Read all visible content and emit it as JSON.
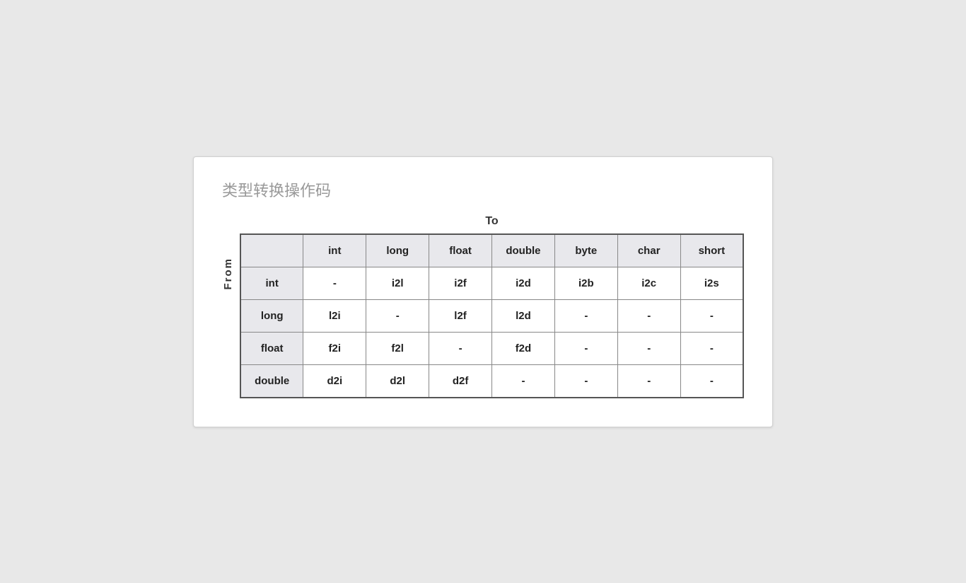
{
  "title": "类型转换操作码",
  "to_label": "To",
  "from_label": "From",
  "columns": [
    "",
    "int",
    "long",
    "float",
    "double",
    "byte",
    "char",
    "short"
  ],
  "rows": [
    {
      "from": "int",
      "cells": [
        "-",
        "i2l",
        "i2f",
        "i2d",
        "i2b",
        "i2c",
        "i2s"
      ]
    },
    {
      "from": "long",
      "cells": [
        "l2i",
        "-",
        "l2f",
        "l2d",
        "-",
        "-",
        "-"
      ]
    },
    {
      "from": "float",
      "cells": [
        "f2i",
        "f2l",
        "-",
        "f2d",
        "-",
        "-",
        "-"
      ]
    },
    {
      "from": "double",
      "cells": [
        "d2i",
        "d2l",
        "d2f",
        "-",
        "-",
        "-",
        "-"
      ]
    }
  ]
}
